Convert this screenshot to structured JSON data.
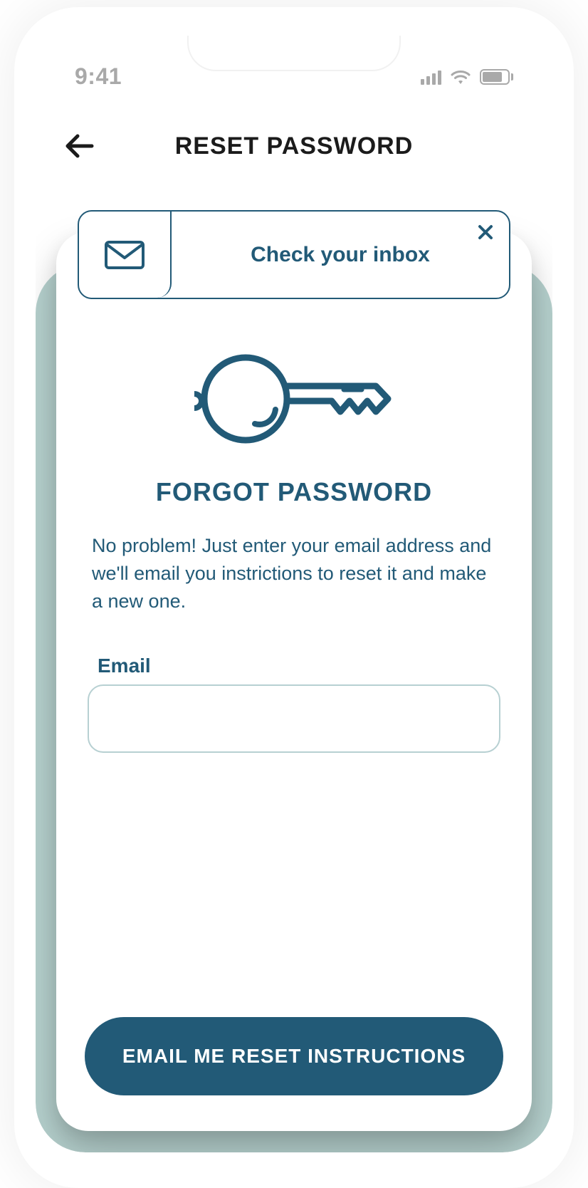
{
  "status_bar": {
    "time": "9:41"
  },
  "header": {
    "title": "RESET PASSWORD"
  },
  "toast": {
    "message": "Check your inbox"
  },
  "main": {
    "heading": "FORGOT PASSWORD",
    "description": "No problem! Just enter your email address and we'll email you instrictions to reset it and make a new one."
  },
  "form": {
    "email_label": "Email",
    "email_value": "",
    "email_placeholder": ""
  },
  "actions": {
    "submit_label": "EMAIL ME RESET INSTRUCTIONS"
  }
}
